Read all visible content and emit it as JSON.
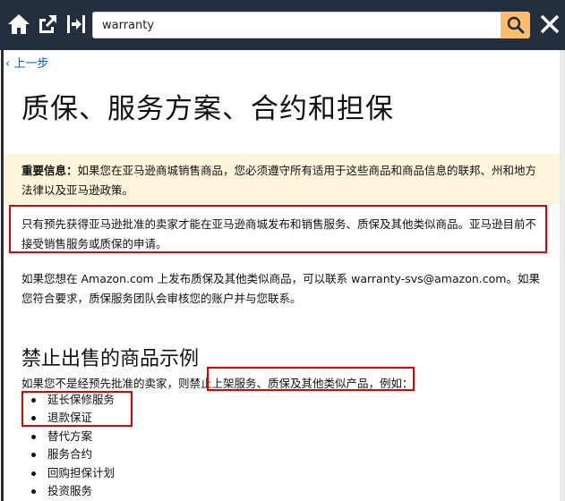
{
  "toolbar": {
    "search_value": "warranty",
    "icons": [
      "home-icon",
      "open-external-icon",
      "collapse-panel-icon",
      "search-icon",
      "close-icon"
    ],
    "colors": {
      "bar": "#232f3e",
      "search_button": "#febd69"
    }
  },
  "nav": {
    "back_label": "上一步"
  },
  "page": {
    "title": "质保、服务方案、合约和担保"
  },
  "notice": {
    "label": "重要信息：",
    "text": "如果您在亚马逊商城销售商品，您必须遵守所有适用于这些商品和商品信息的联邦、州和地方法律以及亚马逊政策。",
    "background": "#fcf4db"
  },
  "paragraphs": {
    "approval": "只有预先获得亚马逊批准的卖家才能在亚马逊商城发布和销售服务、质保及其他类似商品。亚马逊目前不接受销售服务或质保的申请。",
    "contact": "如果您想在 Amazon.com 上发布质保及其他类似商品，可以联系 warranty-svs@amazon.com。如果您符合要求，质保服务团队会审核您的账户并与您联系。"
  },
  "prohibited": {
    "heading": "禁止出售的商品示例",
    "intro_before": "如果您不是经预先批准的卖家，则",
    "intro_highlight": "禁止上架服务、质保及其他类似产品",
    "intro_after": "，例如：",
    "items": [
      "延长保修服务",
      "退款保证",
      "替代方案",
      "服务合约",
      "回购担保计划",
      "投资服务"
    ]
  },
  "annotation_color": "#e00000"
}
